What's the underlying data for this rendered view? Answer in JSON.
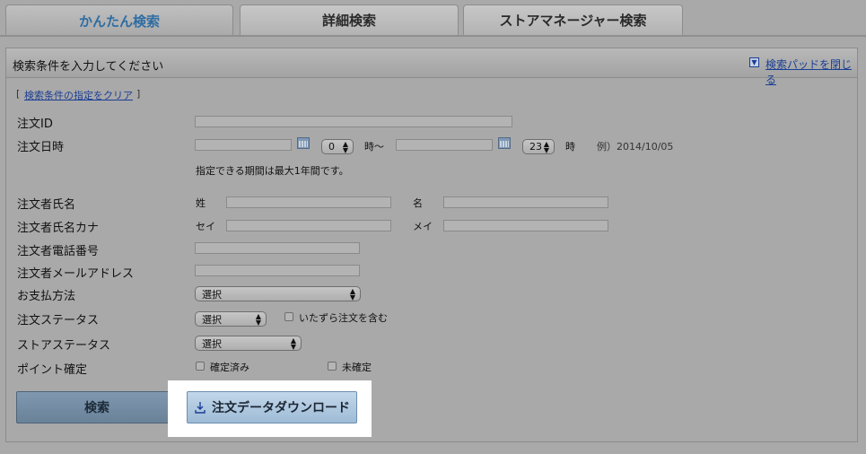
{
  "tabs": [
    {
      "label": "かんたん検索",
      "active": true
    },
    {
      "label": "詳細検索",
      "active": false
    },
    {
      "label": "ストアマネージャー検索",
      "active": false
    }
  ],
  "panel": {
    "title": "検索条件を入力してください",
    "close_link": "検索パッドを閉じる",
    "clear_link": "検索条件の指定をクリア",
    "bracket_open": "[",
    "bracket_close": "]"
  },
  "fields": {
    "order_id": {
      "label": "注文ID",
      "value": ""
    },
    "order_datetime": {
      "label": "注文日時",
      "from_hour": "0",
      "from_suffix": "時〜",
      "to_hour": "23",
      "to_suffix": "時",
      "example": "例）2014/10/05",
      "note": "指定できる期間は最大1年間です。"
    },
    "orderer_name": {
      "label": "注文者氏名",
      "last_label": "姓",
      "first_label": "名"
    },
    "orderer_kana": {
      "label": "注文者氏名カナ",
      "last_label": "セイ",
      "first_label": "メイ"
    },
    "orderer_phone": {
      "label": "注文者電話番号"
    },
    "orderer_email": {
      "label": "注文者メールアドレス"
    },
    "payment_method": {
      "label": "お支払方法",
      "selected": "選択"
    },
    "order_status": {
      "label": "注文ステータス",
      "selected": "選択",
      "mischief_label": "いたずら注文を含む"
    },
    "store_status": {
      "label": "ストアステータス",
      "selected": "選択"
    },
    "point_confirm": {
      "label": "ポイント確定",
      "confirmed_label": "確定済み",
      "unconfirmed_label": "未確定"
    }
  },
  "buttons": {
    "search": "検索",
    "download": "注文データダウンロード"
  },
  "colors": {
    "background": "#a9a9a9",
    "tab_active_text": "#2e6da3",
    "link": "#1b3f94",
    "search_button": "#6f8aa3",
    "download_button": "#a8c3dc"
  }
}
